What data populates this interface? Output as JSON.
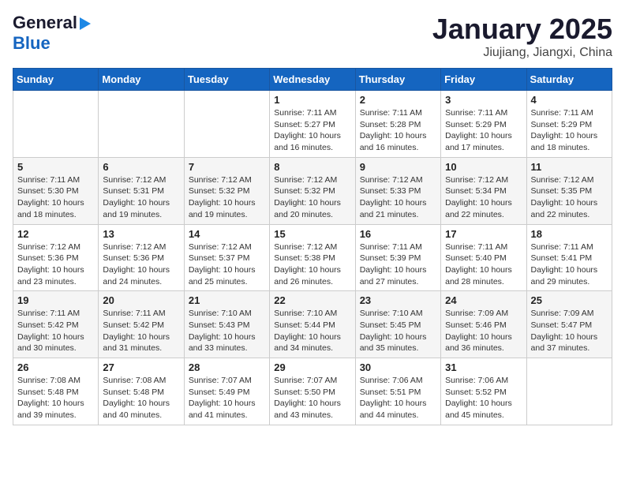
{
  "logo": {
    "general": "General",
    "blue": "Blue"
  },
  "title": "January 2025",
  "location": "Jiujiang, Jiangxi, China",
  "weekdays": [
    "Sunday",
    "Monday",
    "Tuesday",
    "Wednesday",
    "Thursday",
    "Friday",
    "Saturday"
  ],
  "weeks": [
    [
      {
        "day": "",
        "info": ""
      },
      {
        "day": "",
        "info": ""
      },
      {
        "day": "",
        "info": ""
      },
      {
        "day": "1",
        "info": "Sunrise: 7:11 AM\nSunset: 5:27 PM\nDaylight: 10 hours and 16 minutes."
      },
      {
        "day": "2",
        "info": "Sunrise: 7:11 AM\nSunset: 5:28 PM\nDaylight: 10 hours and 16 minutes."
      },
      {
        "day": "3",
        "info": "Sunrise: 7:11 AM\nSunset: 5:29 PM\nDaylight: 10 hours and 17 minutes."
      },
      {
        "day": "4",
        "info": "Sunrise: 7:11 AM\nSunset: 5:29 PM\nDaylight: 10 hours and 18 minutes."
      }
    ],
    [
      {
        "day": "5",
        "info": "Sunrise: 7:11 AM\nSunset: 5:30 PM\nDaylight: 10 hours and 18 minutes."
      },
      {
        "day": "6",
        "info": "Sunrise: 7:12 AM\nSunset: 5:31 PM\nDaylight: 10 hours and 19 minutes."
      },
      {
        "day": "7",
        "info": "Sunrise: 7:12 AM\nSunset: 5:32 PM\nDaylight: 10 hours and 19 minutes."
      },
      {
        "day": "8",
        "info": "Sunrise: 7:12 AM\nSunset: 5:32 PM\nDaylight: 10 hours and 20 minutes."
      },
      {
        "day": "9",
        "info": "Sunrise: 7:12 AM\nSunset: 5:33 PM\nDaylight: 10 hours and 21 minutes."
      },
      {
        "day": "10",
        "info": "Sunrise: 7:12 AM\nSunset: 5:34 PM\nDaylight: 10 hours and 22 minutes."
      },
      {
        "day": "11",
        "info": "Sunrise: 7:12 AM\nSunset: 5:35 PM\nDaylight: 10 hours and 22 minutes."
      }
    ],
    [
      {
        "day": "12",
        "info": "Sunrise: 7:12 AM\nSunset: 5:36 PM\nDaylight: 10 hours and 23 minutes."
      },
      {
        "day": "13",
        "info": "Sunrise: 7:12 AM\nSunset: 5:36 PM\nDaylight: 10 hours and 24 minutes."
      },
      {
        "day": "14",
        "info": "Sunrise: 7:12 AM\nSunset: 5:37 PM\nDaylight: 10 hours and 25 minutes."
      },
      {
        "day": "15",
        "info": "Sunrise: 7:12 AM\nSunset: 5:38 PM\nDaylight: 10 hours and 26 minutes."
      },
      {
        "day": "16",
        "info": "Sunrise: 7:11 AM\nSunset: 5:39 PM\nDaylight: 10 hours and 27 minutes."
      },
      {
        "day": "17",
        "info": "Sunrise: 7:11 AM\nSunset: 5:40 PM\nDaylight: 10 hours and 28 minutes."
      },
      {
        "day": "18",
        "info": "Sunrise: 7:11 AM\nSunset: 5:41 PM\nDaylight: 10 hours and 29 minutes."
      }
    ],
    [
      {
        "day": "19",
        "info": "Sunrise: 7:11 AM\nSunset: 5:42 PM\nDaylight: 10 hours and 30 minutes."
      },
      {
        "day": "20",
        "info": "Sunrise: 7:11 AM\nSunset: 5:42 PM\nDaylight: 10 hours and 31 minutes."
      },
      {
        "day": "21",
        "info": "Sunrise: 7:10 AM\nSunset: 5:43 PM\nDaylight: 10 hours and 33 minutes."
      },
      {
        "day": "22",
        "info": "Sunrise: 7:10 AM\nSunset: 5:44 PM\nDaylight: 10 hours and 34 minutes."
      },
      {
        "day": "23",
        "info": "Sunrise: 7:10 AM\nSunset: 5:45 PM\nDaylight: 10 hours and 35 minutes."
      },
      {
        "day": "24",
        "info": "Sunrise: 7:09 AM\nSunset: 5:46 PM\nDaylight: 10 hours and 36 minutes."
      },
      {
        "day": "25",
        "info": "Sunrise: 7:09 AM\nSunset: 5:47 PM\nDaylight: 10 hours and 37 minutes."
      }
    ],
    [
      {
        "day": "26",
        "info": "Sunrise: 7:08 AM\nSunset: 5:48 PM\nDaylight: 10 hours and 39 minutes."
      },
      {
        "day": "27",
        "info": "Sunrise: 7:08 AM\nSunset: 5:48 PM\nDaylight: 10 hours and 40 minutes."
      },
      {
        "day": "28",
        "info": "Sunrise: 7:07 AM\nSunset: 5:49 PM\nDaylight: 10 hours and 41 minutes."
      },
      {
        "day": "29",
        "info": "Sunrise: 7:07 AM\nSunset: 5:50 PM\nDaylight: 10 hours and 43 minutes."
      },
      {
        "day": "30",
        "info": "Sunrise: 7:06 AM\nSunset: 5:51 PM\nDaylight: 10 hours and 44 minutes."
      },
      {
        "day": "31",
        "info": "Sunrise: 7:06 AM\nSunset: 5:52 PM\nDaylight: 10 hours and 45 minutes."
      },
      {
        "day": "",
        "info": ""
      }
    ]
  ]
}
